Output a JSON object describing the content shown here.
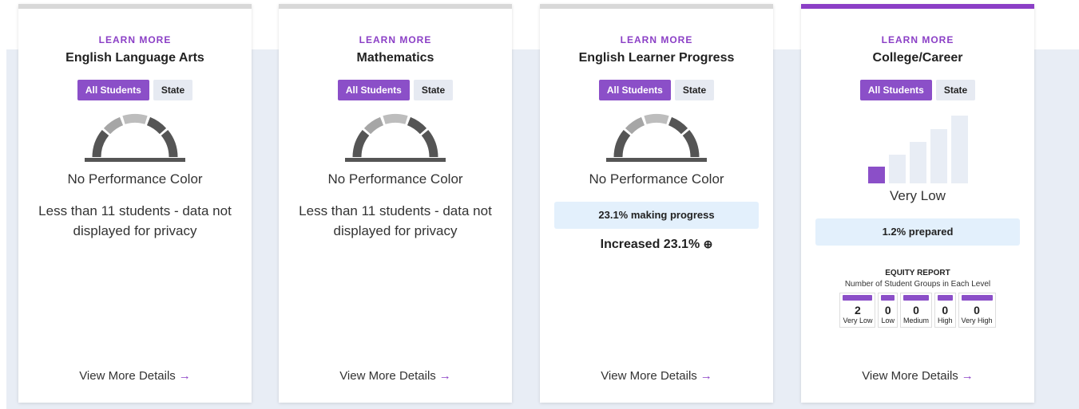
{
  "cards": [
    {
      "learn_more": "LEARN MORE",
      "title": "English Language Arts",
      "toggle": {
        "all": "All Students",
        "state": "State"
      },
      "performance": "No Performance Color",
      "privacy": "Less than 11 students - data not displayed for privacy",
      "details": "View More Details",
      "gauge_icon": "gauge-icon"
    },
    {
      "learn_more": "LEARN MORE",
      "title": "Mathematics",
      "toggle": {
        "all": "All Students",
        "state": "State"
      },
      "performance": "No Performance Color",
      "privacy": "Less than 11 students - data not displayed for privacy",
      "details": "View More Details",
      "gauge_icon": "gauge-icon"
    },
    {
      "learn_more": "LEARN MORE",
      "title": "English Learner Progress",
      "toggle": {
        "all": "All Students",
        "state": "State"
      },
      "performance": "No Performance Color",
      "progress": "23.1% making progress",
      "change": "Increased 23.1%",
      "change_icon": "⊕",
      "details": "View More Details",
      "gauge_icon": "gauge-icon"
    },
    {
      "learn_more": "LEARN MORE",
      "title": "College/Career",
      "toggle": {
        "all": "All Students",
        "state": "State"
      },
      "level": "Very Low",
      "level_index": 1,
      "prepared": "1.2% prepared",
      "equity": {
        "title": "EQUITY REPORT",
        "subtitle": "Number of Student Groups in Each Level",
        "levels": [
          {
            "count": "2",
            "label": "Very Low"
          },
          {
            "count": "0",
            "label": "Low"
          },
          {
            "count": "0",
            "label": "Medium"
          },
          {
            "count": "0",
            "label": "High"
          },
          {
            "count": "0",
            "label": "Very High"
          }
        ]
      },
      "details": "View More Details"
    }
  ],
  "colors": {
    "accent": "#8b3fc6",
    "gauge_dark": "#555555",
    "gauge_light": "#a6a6a6",
    "info_bg": "#e3f0fc"
  },
  "icons": {
    "arrow": "→",
    "info_up": "⊕"
  }
}
